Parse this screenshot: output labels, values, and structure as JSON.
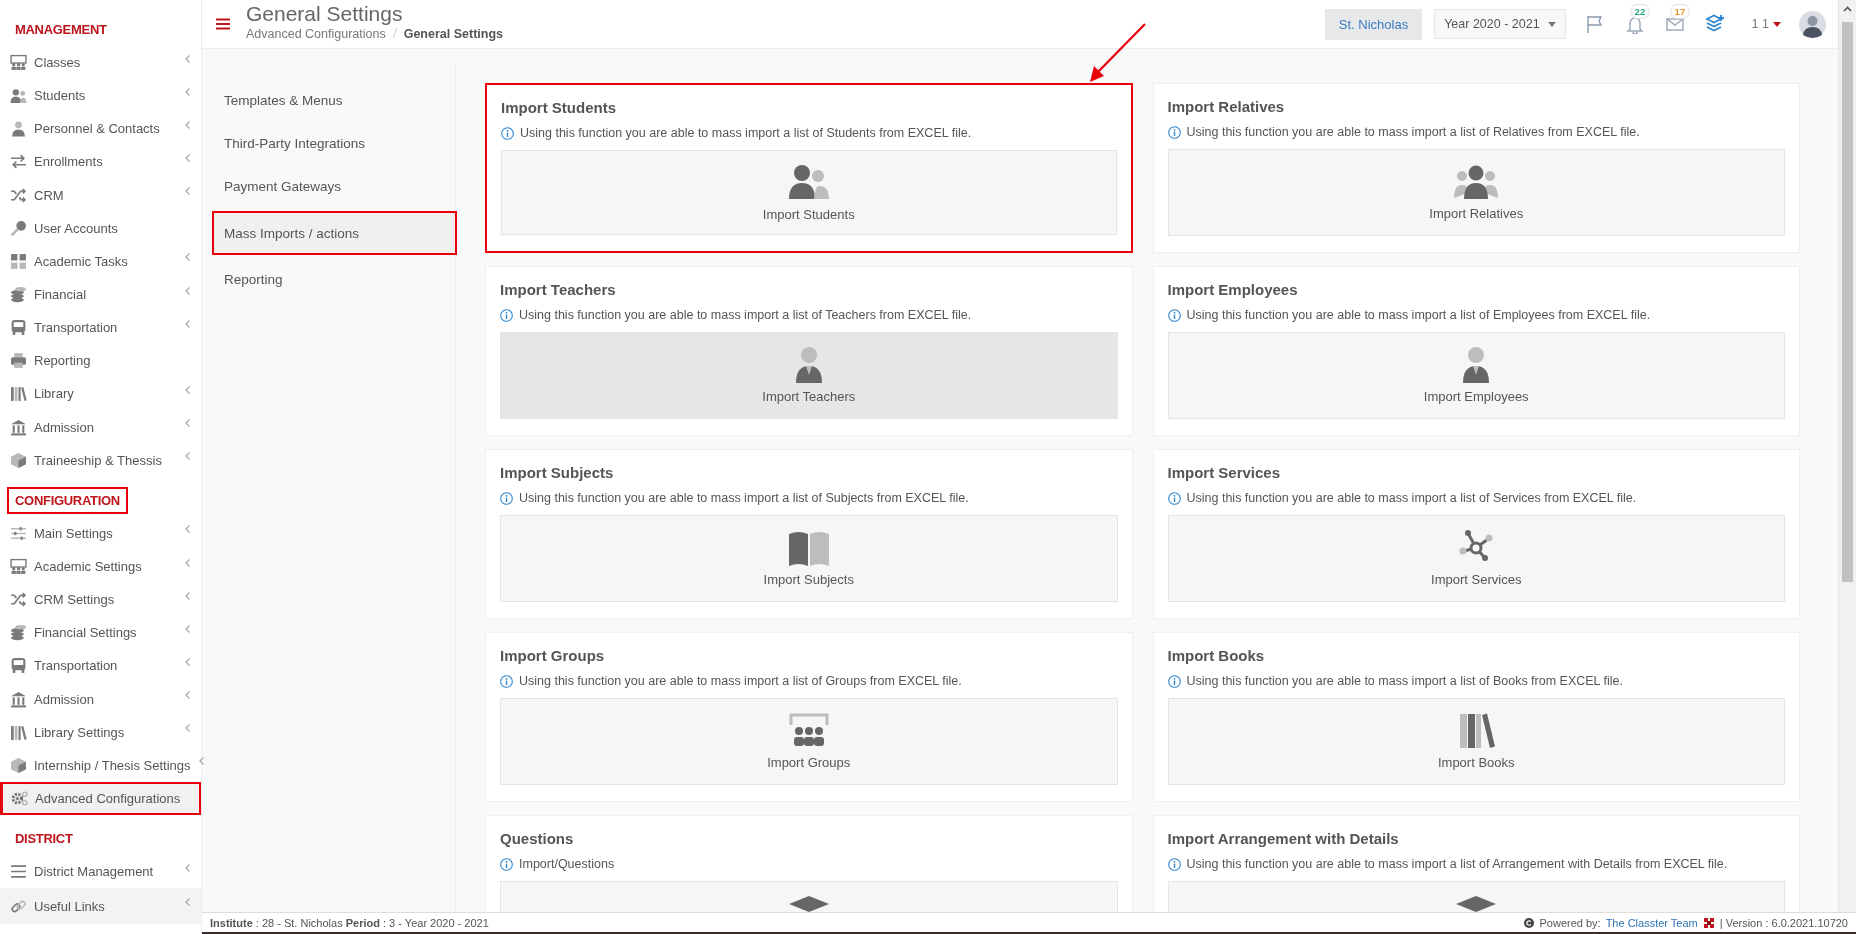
{
  "sidebar": {
    "sections": [
      {
        "label": "MANAGEMENT",
        "highlighted": false,
        "items": [
          {
            "label": "Classes",
            "kind": "classroom",
            "expandable": true,
            "selected": false,
            "highlighted": false
          },
          {
            "label": "Students",
            "kind": "users",
            "expandable": true,
            "selected": false,
            "highlighted": false
          },
          {
            "label": "Personnel & Contacts",
            "kind": "person",
            "expandable": true,
            "selected": false,
            "highlighted": false
          },
          {
            "label": "Enrollments",
            "kind": "exchange",
            "expandable": true,
            "selected": false,
            "highlighted": false
          },
          {
            "label": "CRM",
            "kind": "shuffle",
            "expandable": true,
            "selected": false,
            "highlighted": false
          },
          {
            "label": "User Accounts",
            "kind": "key",
            "expandable": false,
            "selected": false,
            "highlighted": false
          },
          {
            "label": "Academic Tasks",
            "kind": "tiles",
            "expandable": true,
            "selected": false,
            "highlighted": false
          },
          {
            "label": "Financial",
            "kind": "coins",
            "expandable": true,
            "selected": false,
            "highlighted": false
          },
          {
            "label": "Transportation",
            "kind": "bus",
            "expandable": true,
            "selected": false,
            "highlighted": false
          },
          {
            "label": "Reporting",
            "kind": "printer",
            "expandable": false,
            "selected": false,
            "highlighted": false
          },
          {
            "label": "Library",
            "kind": "books",
            "expandable": true,
            "selected": false,
            "highlighted": false
          },
          {
            "label": "Admission",
            "kind": "bank",
            "expandable": true,
            "selected": false,
            "highlighted": false
          },
          {
            "label": "Traineeship & Thessis",
            "kind": "cube",
            "expandable": true,
            "selected": false,
            "highlighted": false
          }
        ]
      },
      {
        "label": "CONFIGURATION",
        "highlighted": true,
        "items": [
          {
            "label": "Main Settings",
            "kind": "sliders",
            "expandable": true,
            "selected": false,
            "highlighted": false
          },
          {
            "label": "Academic Settings",
            "kind": "classroom",
            "expandable": true,
            "selected": false,
            "highlighted": false
          },
          {
            "label": "CRM Settings",
            "kind": "shuffle",
            "expandable": true,
            "selected": false,
            "highlighted": false
          },
          {
            "label": "Financial Settings",
            "kind": "coins",
            "expandable": true,
            "selected": false,
            "highlighted": false
          },
          {
            "label": "Transportation",
            "kind": "bus",
            "expandable": true,
            "selected": false,
            "highlighted": false
          },
          {
            "label": "Admission",
            "kind": "bank",
            "expandable": true,
            "selected": false,
            "highlighted": false
          },
          {
            "label": "Library Settings",
            "kind": "books",
            "expandable": true,
            "selected": false,
            "highlighted": false
          },
          {
            "label": "Internship / Thesis Settings",
            "kind": "cube",
            "expandable": true,
            "selected": false,
            "highlighted": false
          },
          {
            "label": "Advanced Configurations",
            "kind": "gears",
            "expandable": false,
            "selected": true,
            "highlighted": true
          }
        ]
      },
      {
        "label": "DISTRICT",
        "highlighted": false,
        "items": [
          {
            "label": "District Management",
            "kind": "list",
            "expandable": true,
            "selected": false,
            "highlighted": false
          }
        ]
      }
    ],
    "footer_link": {
      "label": "Useful Links",
      "kind": "link",
      "expandable": true
    }
  },
  "header": {
    "title": "General Settings",
    "breadcrumb": [
      "Advanced Configurations",
      "General Settings"
    ],
    "institute": "St. Nicholas",
    "year": "Year 2020 - 2021",
    "notifications": [
      {
        "kind": "flag"
      },
      {
        "kind": "bell",
        "badge": "22",
        "color": "#27a776"
      },
      {
        "kind": "mail",
        "badge": "17",
        "color": "#f0932b"
      },
      {
        "kind": "layers"
      }
    ],
    "user_label": "1 1"
  },
  "submenu": [
    {
      "label": "Templates & Menus",
      "selected": false,
      "highlighted": false
    },
    {
      "label": "Third-Party Integrations",
      "selected": false,
      "highlighted": false
    },
    {
      "label": "Payment Gateways",
      "selected": false,
      "highlighted": false
    },
    {
      "label": "Mass Imports / actions",
      "selected": true,
      "highlighted": true
    },
    {
      "label": "Reporting",
      "selected": false,
      "highlighted": false
    }
  ],
  "cards": [
    {
      "title": "Import Students",
      "info": "Using this function you are able to mass import a list of Students from EXCEL file.",
      "kind": "students",
      "action": "Import Students",
      "hovered": false,
      "highlighted": true
    },
    {
      "title": "Import Relatives",
      "info": "Using this function you are able to mass import a list of Relatives from EXCEL file.",
      "kind": "relatives",
      "action": "Import Relatives",
      "hovered": false,
      "highlighted": false
    },
    {
      "title": "Import Teachers",
      "info": "Using this function you are able to mass import a list of Teachers from EXCEL file.",
      "kind": "employee",
      "action": "Import Teachers",
      "hovered": true,
      "highlighted": false
    },
    {
      "title": "Import Employees",
      "info": "Using this function you are able to mass import a list of Employees from EXCEL file.",
      "kind": "employee",
      "action": "Import Employees",
      "hovered": false,
      "highlighted": false
    },
    {
      "title": "Import Subjects",
      "info": "Using this function you are able to mass import a list of Subjects from EXCEL file.",
      "kind": "book",
      "action": "Import Subjects",
      "hovered": false,
      "highlighted": false
    },
    {
      "title": "Import Services",
      "info": "Using this function you are able to mass import a list of Services from EXCEL file.",
      "kind": "network",
      "action": "Import Services",
      "hovered": false,
      "highlighted": false
    },
    {
      "title": "Import Groups",
      "info": "Using this function you are able to mass import a list of Groups from EXCEL file.",
      "kind": "groups",
      "action": "Import Groups",
      "hovered": false,
      "highlighted": false
    },
    {
      "title": "Import Books",
      "info": "Using this function you are able to mass import a list of Books from EXCEL file.",
      "kind": "books",
      "action": "Import Books",
      "hovered": false,
      "highlighted": false
    },
    {
      "title": "Questions",
      "info": "Import/Questions",
      "kind": "cap",
      "hovered": false,
      "highlighted": false
    },
    {
      "title": "Import Arrangement with Details",
      "info": "Using this function you are able to mass import a list of Arrangement with Details from EXCEL file.",
      "kind": "cap",
      "hovered": false,
      "highlighted": false
    }
  ],
  "annotation_arrow": true,
  "footer": {
    "status": "**Institute** : 28 - St. Nicholas **Period** : 3 - Year 2020 - 2021",
    "powered_by": "Powered by:",
    "team": "The Classter Team",
    "version": "| Version : 6.0.2021.10720"
  }
}
